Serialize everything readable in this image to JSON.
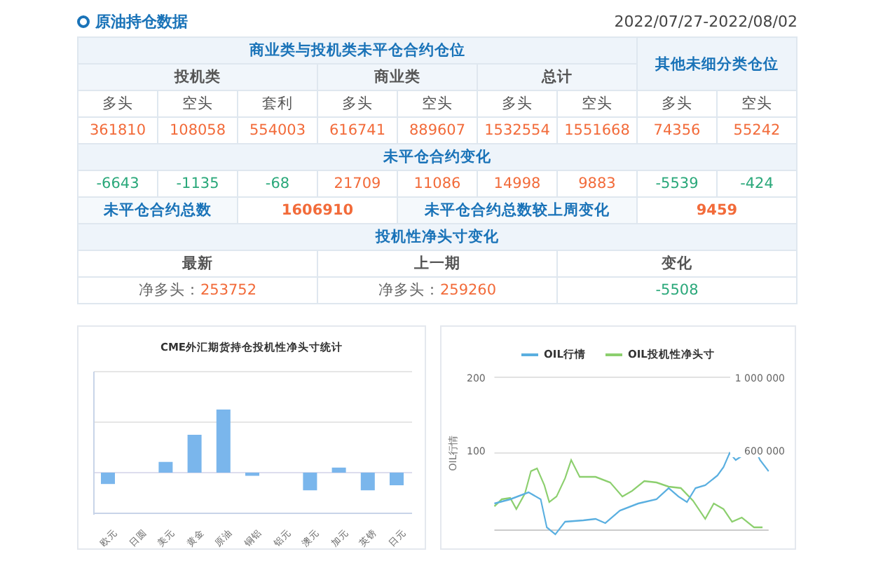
{
  "header": {
    "title": "原油持仓数据",
    "date_range": "2022/07/27-2022/08/02"
  },
  "table": {
    "group_title": "商业类与投机类未平仓合约仓位",
    "other_title": "其他未细分类仓位",
    "groups": [
      "投机类",
      "商业类",
      "总计"
    ],
    "columns": [
      "多头",
      "空头",
      "套利",
      "多头",
      "空头",
      "多头",
      "空头",
      "多头",
      "空头"
    ],
    "positions": [
      "361810",
      "108058",
      "554003",
      "616741",
      "889607",
      "1532554",
      "1551668",
      "74356",
      "55242"
    ],
    "change_title": "未平仓合约变化",
    "changes": [
      {
        "value": "-6643",
        "color": "#2aa87a"
      },
      {
        "value": "-1135",
        "color": "#2aa87a"
      },
      {
        "value": "-68",
        "color": "#2aa87a"
      },
      {
        "value": "21709",
        "color": "#f26b3a"
      },
      {
        "value": "11086",
        "color": "#f26b3a"
      },
      {
        "value": "14998",
        "color": "#f26b3a"
      },
      {
        "value": "9883",
        "color": "#f26b3a"
      },
      {
        "value": "-5539",
        "color": "#2aa87a"
      },
      {
        "value": "-424",
        "color": "#2aa87a"
      }
    ],
    "total_label": "未平仓合约总数",
    "total_value": "1606910",
    "total_change_label": "未平仓合约总数较上周变化",
    "total_change_value": "9459",
    "net_title": "投机性净头寸变化",
    "net_columns": [
      {
        "label": "最新",
        "prefix": "净多头：",
        "value": "253752",
        "color": "#f26b3a"
      },
      {
        "label": "上一期",
        "prefix": "净多头：",
        "value": "259260",
        "color": "#f26b3a"
      },
      {
        "label": "变化",
        "value": "-5508",
        "color": "#2aa87a"
      }
    ]
  },
  "bar_chart": {
    "title": "CME外汇期货持仓投机性净头寸统计",
    "categories": [
      "欧元",
      "日圆",
      "美元",
      "黄金",
      "原油",
      "铜铝",
      "铝元",
      "澳元",
      "加元",
      "英镑",
      "日元"
    ]
  },
  "line_chart": {
    "legend": [
      {
        "name": "OIL行情",
        "color": "#5aafe0"
      },
      {
        "name": "OIL投机性净头寸",
        "color": "#8ccf6e"
      }
    ],
    "ylabel": "OIL行情",
    "left_ticks": [
      "200",
      "100"
    ],
    "right_ticks": [
      "1 000 000",
      "600 000"
    ]
  }
}
